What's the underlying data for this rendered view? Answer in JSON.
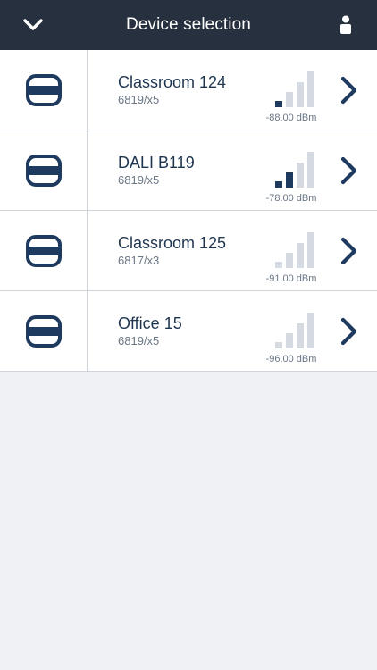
{
  "header": {
    "title": "Device selection",
    "back_icon": "chevron-down-icon",
    "user_icon": "user-icon",
    "background": "#26303e"
  },
  "devices": [
    {
      "name": "Classroom 124",
      "model": "6819/x5",
      "signal_text": "-88.00 dBm",
      "signal_level": 1
    },
    {
      "name": "DALI B119",
      "model": "6819/x5",
      "signal_text": "-78.00 dBm",
      "signal_level": 2
    },
    {
      "name": "Classroom 125",
      "model": "6817/x3",
      "signal_text": "-91.00 dBm",
      "signal_level": 0
    },
    {
      "name": "Office 15",
      "model": "6819/x5",
      "signal_text": "-96.00 dBm",
      "signal_level": 0
    }
  ],
  "colors": {
    "accent": "#1f3a5f",
    "signal_inactive": "#d5dae1",
    "background": "#f0f1f4"
  }
}
